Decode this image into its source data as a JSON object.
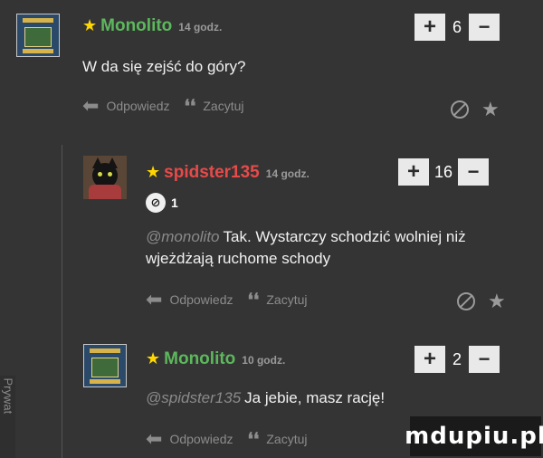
{
  "comments": [
    {
      "username": "Monolito",
      "time": "14 godz.",
      "votes": "6",
      "text": "W da się zejść do góry?",
      "mention": "",
      "reply_label": "Odpowiedz",
      "quote_label": "Zacytuj",
      "badge_count": ""
    },
    {
      "username": "spidster135",
      "time": "14 godz.",
      "votes": "16",
      "text": "Tak. Wystarczy schodzić wolniej niż wjeżdżają ruchome schody",
      "mention": "@monolito",
      "reply_label": "Odpowiedz",
      "quote_label": "Zacytuj",
      "badge_count": "1"
    },
    {
      "username": "Monolito",
      "time": "10 godz.",
      "votes": "2",
      "text": "Ja jebie, masz rację!",
      "mention": "@spidster135",
      "reply_label": "Odpowiedz",
      "quote_label": "Zacytuj",
      "badge_count": ""
    }
  ],
  "vote_plus": "+",
  "vote_minus": "−",
  "sidebar_tab": "Prywat",
  "watermark": "mdupiu.pl",
  "colors": {
    "background": "#343434",
    "username_green": "#5cb85c",
    "username_red": "#e84a4a",
    "star": "#ffd700"
  },
  "icons": [
    "reply-arrow-icon",
    "quote-icon",
    "no-entry-icon",
    "star-icon"
  ]
}
